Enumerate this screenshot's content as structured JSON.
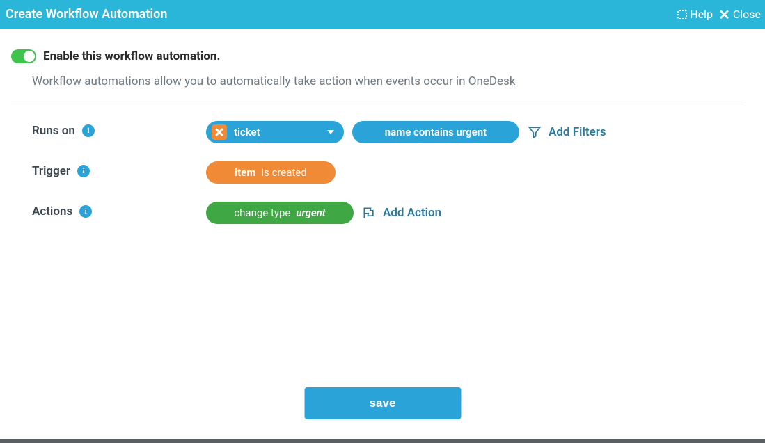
{
  "header": {
    "title": "Create Workflow Automation",
    "help_label": "Help",
    "close_label": "Close"
  },
  "enable": {
    "label": "Enable this workflow automation.",
    "on": true
  },
  "description": "Workflow automations allow you to automatically take action when events occur in OneDesk",
  "rows": {
    "runs_on": {
      "label": "Runs on",
      "type_value": "ticket",
      "filter_value": "name contains urgent",
      "add_filters_label": "Add Filters"
    },
    "trigger": {
      "label": "Trigger",
      "subject": "item",
      "predicate": "is created"
    },
    "actions": {
      "label": "Actions",
      "action_name": "change type",
      "action_value": "urgent",
      "add_action_label": "Add Action"
    }
  },
  "save_label": "save"
}
